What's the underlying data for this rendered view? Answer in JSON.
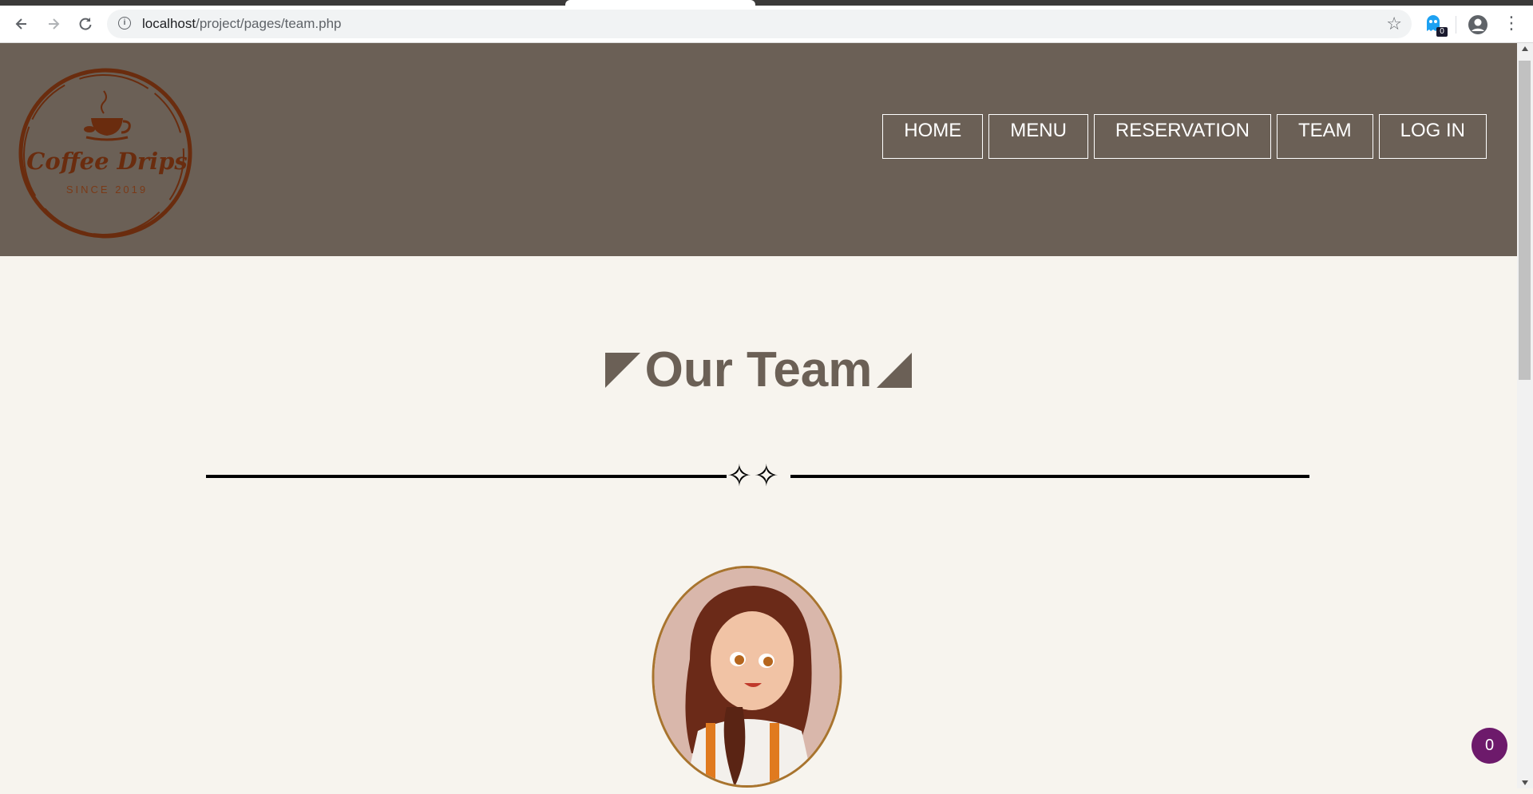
{
  "browser": {
    "url_host": "localhost",
    "url_path": "/project/pages/team.php",
    "extension_badge": "0"
  },
  "site": {
    "logo": {
      "title": "Coffee Drips",
      "subtitle": "SINCE 2019"
    },
    "nav": [
      {
        "label": "HOME"
      },
      {
        "label": "MENU"
      },
      {
        "label": "RESERVATION"
      },
      {
        "label": "TEAM"
      },
      {
        "label": "LOG IN"
      }
    ]
  },
  "main": {
    "title": "Our Team",
    "divider_ornament": "✧✧"
  },
  "cart": {
    "count": "0"
  },
  "colors": {
    "header_bg": "#6b6056",
    "page_bg": "#f7f4ee",
    "logo_brown": "#6a2c0e",
    "avatar_border": "#a8742e",
    "cart_bubble": "#6d1a6b"
  }
}
